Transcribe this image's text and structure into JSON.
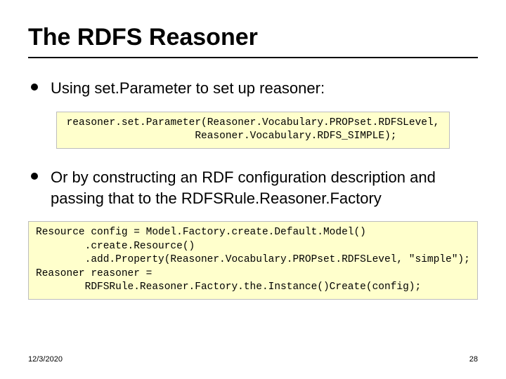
{
  "title": "The RDFS Reasoner",
  "bullets": {
    "b1": "Using set.Parameter to set up reasoner:",
    "b2": "Or by constructing an RDF configuration description and passing that to the RDFSRule.Reasoner.Factory"
  },
  "code": {
    "c1": "reasoner.set.Parameter(Reasoner.Vocabulary.PROPset.RDFSLevel,\n              Reasoner.Vocabulary.RDFS_SIMPLE);",
    "c2": "Resource config = Model.Factory.create.Default.Model()\n        .create.Resource()\n        .add.Property(Reasoner.Vocabulary.PROPset.RDFSLevel, \"simple\");\nReasoner reasoner =\n        RDFSRule.Reasoner.Factory.the.Instance()Create(config);"
  },
  "footer": {
    "date": "12/3/2020",
    "page": "28"
  }
}
